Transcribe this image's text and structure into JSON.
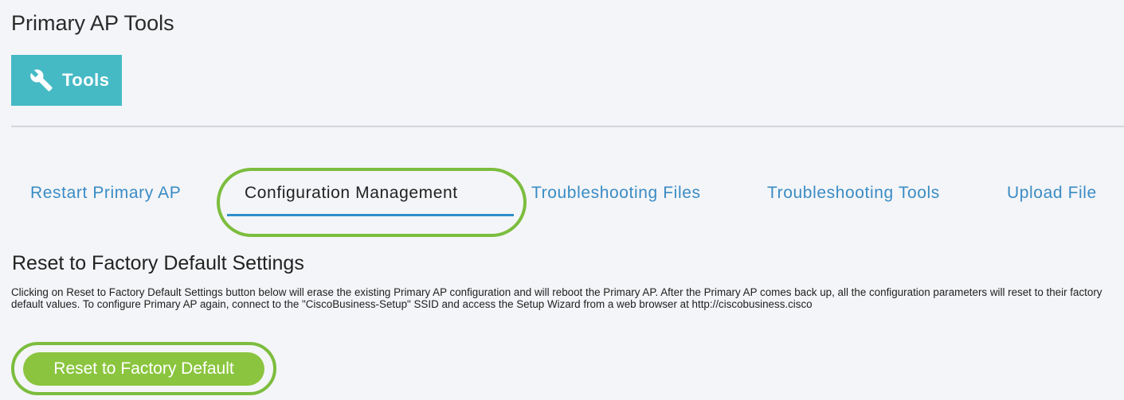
{
  "page": {
    "title": "Primary AP Tools"
  },
  "tools_tile": {
    "label": "Tools",
    "icon": "wrench-icon",
    "color": "#45bac5"
  },
  "tabs": [
    {
      "label": "Restart Primary AP",
      "active": false
    },
    {
      "label": "Configuration Management",
      "active": true
    },
    {
      "label": "Troubleshooting Files",
      "active": false
    },
    {
      "label": "Troubleshooting Tools",
      "active": false
    },
    {
      "label": "Upload File",
      "active": false
    }
  ],
  "section": {
    "title": "Reset to Factory Default Settings",
    "description": "Clicking on Reset to Factory Default Settings button below will erase the existing Primary AP configuration and will reboot the Primary AP. After the Primary AP comes back up, all the configuration parameters will reset to their factory default values. To configure Primary AP again, connect to the \"CiscoBusiness-Setup\" SSID and access the Setup Wizard from a web browser at http://ciscobusiness.cisco",
    "button_label": "Reset to Factory Default"
  },
  "colors": {
    "link": "#3a8cc4",
    "tab_underline": "#2f8ec9",
    "highlight": "#7cbd3e",
    "button": "#8bc53f"
  }
}
